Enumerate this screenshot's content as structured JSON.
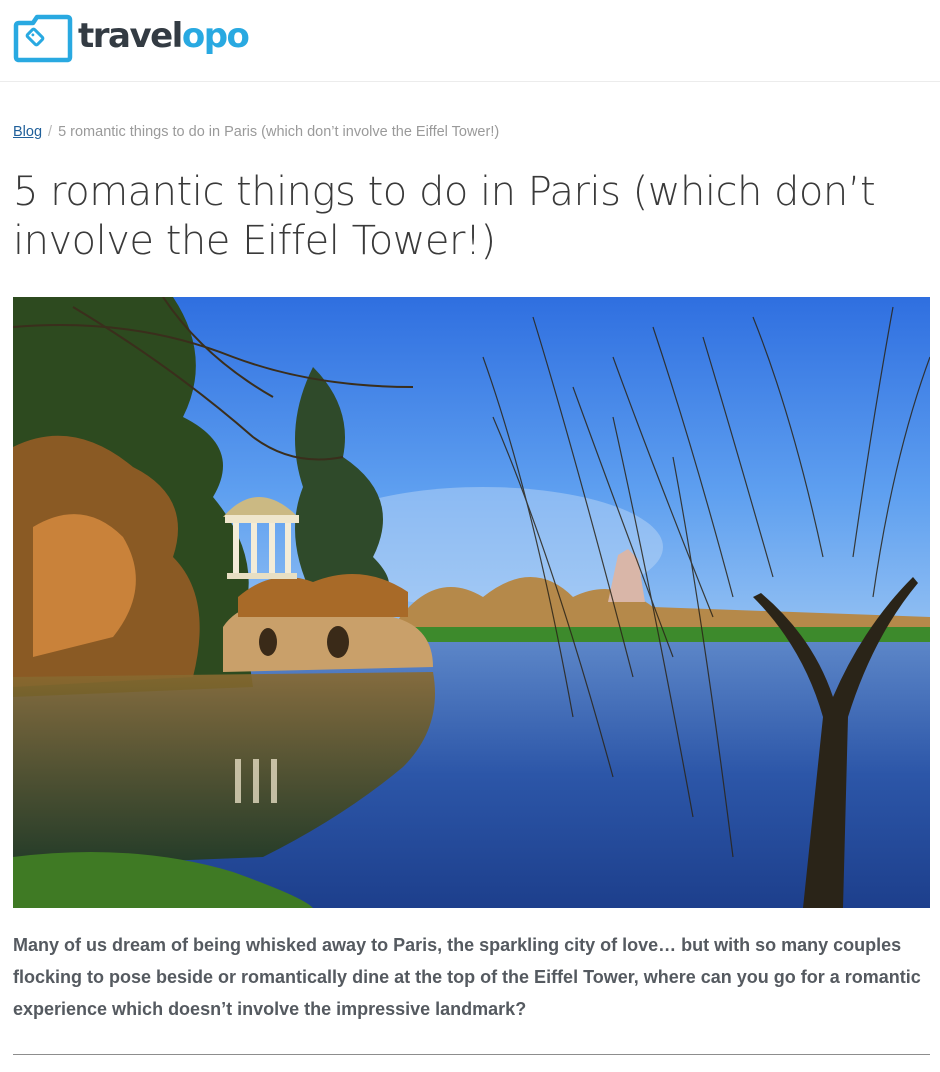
{
  "brand": {
    "name_part1": "travel",
    "name_part2": "opo",
    "colors": {
      "dark": "#333b43",
      "accent": "#29a9e1"
    },
    "icon": "luggage-tag-logo-icon"
  },
  "breadcrumb": {
    "home_label": "Blog",
    "separator": "/",
    "current": "5 romantic things to do in Paris (which don’t involve the Eiffel Tower!)"
  },
  "article": {
    "title": "5 romantic things to do in Paris (which don’t involve the Eiffel Tower!)",
    "intro": "Many of us dream of being whisked away to Paris, the sparkling city of love… but with so many couples flocking to pose beside or romantically dine at the top of the Eiffel Tower, where can you go for a romantic experience which doesn’t involve the impressive landmark?"
  }
}
